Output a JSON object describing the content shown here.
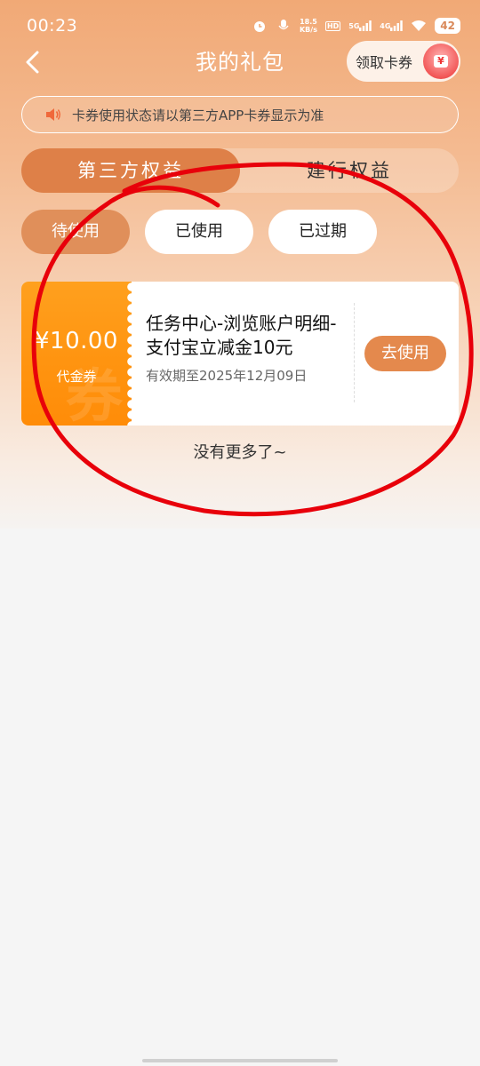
{
  "status_bar": {
    "time": "00:23",
    "net_speed_top": "18.5",
    "net_speed_bottom": "KB/s",
    "hd_label": "HD",
    "signal_5g": "5G",
    "signal_4g": "4G",
    "battery": "42",
    "icons": [
      "alarm-icon",
      "mic-icon",
      "hd-icon",
      "signal-icon",
      "wifi-icon"
    ]
  },
  "nav": {
    "title": "我的礼包",
    "back_icon": "chevron-left-icon",
    "coupon_entry_label": "领取卡券",
    "coupon_entry_badge": "¥"
  },
  "notice": {
    "icon": "speaker-icon",
    "text": "卡券使用状态请以第三方APP卡券显示为准"
  },
  "main_tabs": [
    {
      "label": "第三方权益",
      "active": true
    },
    {
      "label": "建行权益",
      "active": false
    }
  ],
  "sub_tabs": [
    {
      "label": "待使用",
      "active": true
    },
    {
      "label": "已使用",
      "active": false
    },
    {
      "label": "已过期",
      "active": false
    }
  ],
  "coupons": [
    {
      "amount": "¥10.00",
      "type": "代金券",
      "watermark": "券",
      "title": "任务中心-浏览账户明细-支付宝立减金10元",
      "expiry": "有效期至2025年12月09日",
      "action": "去使用"
    }
  ],
  "list_footer": "没有更多了~",
  "colors": {
    "accent": "#de8048",
    "coupon_orange": "#ff9410",
    "annotation_red": "#e8000a"
  }
}
